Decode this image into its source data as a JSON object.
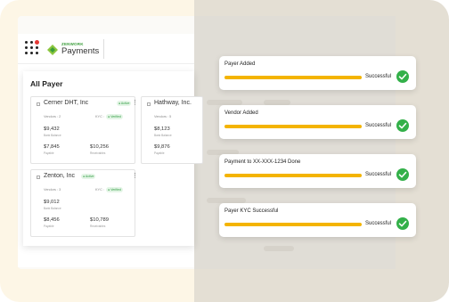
{
  "brand": {
    "small": "ZENWORK",
    "name": "Payments"
  },
  "panel": {
    "title": "All Payer"
  },
  "cards": [
    {
      "name": "Cerner DHT, Inc",
      "status": "Active",
      "vendors": "Vendors : 2",
      "kyc_label": "KYC :",
      "kyc_status": "Verified",
      "bank_amount": "$9,432",
      "bank_label": "Bank Balance",
      "payable_amount": "$7,845",
      "payable_label": "Payable",
      "receivable_amount": "$10,256",
      "receivable_label": "Receivables"
    },
    {
      "name": "Hathway, Inc.",
      "vendors": "Vendors : 5",
      "bank_amount": "$8,123",
      "bank_label": "Bank Balance",
      "payable_amount": "$9,876",
      "payable_label": "Payable"
    },
    {
      "name": "Zenton, Inc",
      "status": "Active",
      "vendors": "Vendors : 3",
      "kyc_label": "KYC :",
      "kyc_status": "Verified",
      "bank_amount": "$9,012",
      "bank_label": "Bank Balance",
      "payable_amount": "$8,456",
      "payable_label": "Payable",
      "receivable_amount": "$10,789",
      "receivable_label": "Receivables"
    }
  ],
  "notifications": [
    {
      "title": "Payer Added",
      "status": "Successful"
    },
    {
      "title": "Vendor Added",
      "status": "Successful"
    },
    {
      "title": "Payment to XX-XXX-1234 Done",
      "status": "Successful"
    },
    {
      "title": "Payer KYC Successful",
      "status": "Successful"
    }
  ],
  "colors": {
    "accent_green": "#33b049",
    "progress_yellow": "#f4b400",
    "left_background": "#fdf6e6",
    "right_background": "#e4dfd4"
  }
}
